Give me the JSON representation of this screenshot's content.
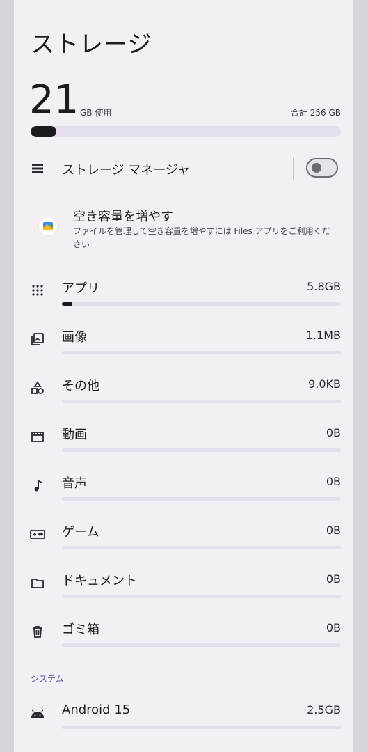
{
  "header": {
    "title": "ストレージ"
  },
  "summary": {
    "used_value": "21",
    "used_unit": "GB 使用",
    "total_label": "合計 256 GB",
    "used_fraction": 0.082
  },
  "storage_manager": {
    "label": "ストレージ マネージャ",
    "enabled": false
  },
  "promo": {
    "title": "空き容量を増やす",
    "description": "ファイルを管理して空き容量を増やすには Files アプリをご利用ください"
  },
  "categories": [
    {
      "label": "アプリ",
      "value": "5.8GB",
      "fraction": 0.035,
      "icon": "apps-grid-icon"
    },
    {
      "label": "画像",
      "value": "1.1MB",
      "fraction": 0,
      "icon": "image-icon"
    },
    {
      "label": "その他",
      "value": "9.0KB",
      "fraction": 0,
      "icon": "shapes-icon"
    },
    {
      "label": "動画",
      "value": "0B",
      "fraction": 0,
      "icon": "video-icon"
    },
    {
      "label": "音声",
      "value": "0B",
      "fraction": 0,
      "icon": "music-note-icon"
    },
    {
      "label": "ゲーム",
      "value": "0B",
      "fraction": 0,
      "icon": "gamepad-icon"
    },
    {
      "label": "ドキュメント",
      "value": "0B",
      "fraction": 0,
      "icon": "folder-icon"
    },
    {
      "label": "ゴミ箱",
      "value": "0B",
      "fraction": 0,
      "icon": "trash-icon"
    }
  ],
  "system": {
    "section_label": "システム",
    "items": [
      {
        "label": "Android 15",
        "value": "2.5GB",
        "icon": "android-icon"
      }
    ]
  },
  "colors": {
    "background": "#f3eff5",
    "bar_track": "#e4dfea",
    "bar_fill": "#1c1b1f",
    "section_accent": "#5f5aa8"
  }
}
